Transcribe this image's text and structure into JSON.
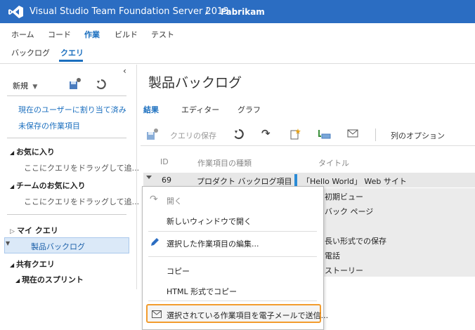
{
  "header": {
    "app_title": "Visual Studio Team Foundation Server 2013",
    "separator": "/",
    "project": "Fabrikam"
  },
  "main_nav": [
    "ホーム",
    "コード",
    "作業",
    "ビルド",
    "テスト"
  ],
  "sub_nav": [
    "バックログ",
    "クエリ"
  ],
  "left_pane": {
    "new_label": "新規",
    "links": [
      "現在のユーザーに割り当て済み",
      "未保存の作業項目"
    ],
    "favorites_head": "お気に入り",
    "favorites_placeholder": "ここにクエリをドラッグして追...",
    "team_favorites_head": "チームのお気に入り",
    "team_favorites_placeholder": "ここにクエリをドラッグして追...",
    "my_queries_head": "マイ クエリ",
    "my_queries_selected": "製品バックログ",
    "shared_queries_head": "共有クエリ",
    "current_sprint": "現在のスプリント"
  },
  "main": {
    "title": "製品バックログ",
    "tabs": [
      "結果",
      "エディター",
      "グラフ"
    ],
    "toolbar": {
      "save_query": "クエリの保存",
      "column_options": "列のオプション"
    },
    "columns": [
      "ID",
      "作業項目の種類",
      "タイトル"
    ],
    "rows": [
      {
        "id": "69",
        "type": "プロダクト バックログ項目",
        "title": "「Hello World」 Web サイト"
      },
      {
        "title": "初期ビュー"
      },
      {
        "title": "バック ページ"
      },
      {
        "title": "長い形式での保存"
      },
      {
        "title": "電話"
      },
      {
        "title": "ストーリー"
      }
    ]
  },
  "context_menu": {
    "open": "開く",
    "open_new_window": "新しいウィンドウで開く",
    "edit_selected": "選択した作業項目の編集...",
    "copy": "コピー",
    "copy_html": "HTML 形式でコピー",
    "email_selected": "選択されている作業項目を電子メールで送信..."
  },
  "colors": {
    "brand_blue": "#2b6dc2",
    "accent_blue": "#1b6fbf",
    "highlight_orange": "#f29c2e"
  }
}
